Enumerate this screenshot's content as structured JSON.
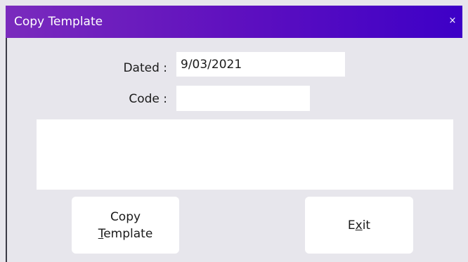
{
  "window": {
    "title": "Copy Template",
    "close_glyph": "×"
  },
  "form": {
    "dated_label": "Dated :",
    "dated_value": "9/03/2021",
    "code_label": "Code :",
    "code_value": "",
    "notes_value": ""
  },
  "buttons": {
    "copy_line1": "Copy",
    "copy_mnemonic": "T",
    "copy_rest": "emplate",
    "exit_pre": "E",
    "exit_mnemonic": "x",
    "exit_rest": "it"
  },
  "colors": {
    "titlebar_start": "#7a2bbd",
    "titlebar_end": "#3d00c7",
    "background": "#e7e6ec",
    "field": "#ffffff"
  }
}
